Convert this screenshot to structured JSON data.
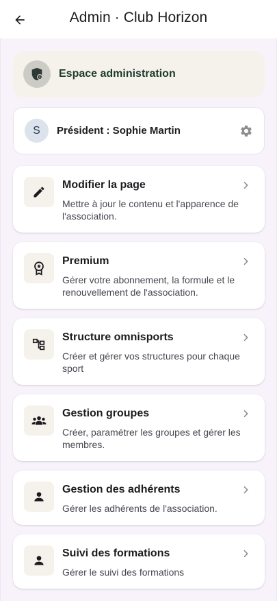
{
  "appbar": {
    "title": "Admin · Club Horizon",
    "back_icon": "arrow-left-icon"
  },
  "banner": {
    "label": "Espace administration",
    "icon": "shield-admin-icon"
  },
  "president": {
    "initial": "S",
    "label": "Président : Sophie Martin",
    "settings_icon": "gear-icon"
  },
  "menu": [
    {
      "title": "Modifier la page",
      "description": "Mettre à jour le contenu et l'apparence de l'association.",
      "icon": "pencil-icon"
    },
    {
      "title": "Premium",
      "description": "Gérer votre abonnement, la formule et le renouvellement de l'association.",
      "icon": "award-icon"
    },
    {
      "title": "Structure omnisports",
      "description": "Créer et gérer vos structures pour chaque sport",
      "icon": "hierarchy-icon"
    },
    {
      "title": "Gestion groupes",
      "description": "Créer, paramétrer les groupes et gérer les membres.",
      "icon": "group-icon"
    },
    {
      "title": "Gestion des adhérents",
      "description": "Gérer les adhérents de l'association.",
      "icon": "person-icon"
    },
    {
      "title": "Suivi des formations",
      "description": "Gérer le suivi des formations",
      "icon": "person-icon"
    }
  ],
  "colors": {
    "page_background": "#f8f3fb",
    "banner_background": "#f5f2ec",
    "banner_text": "#1f3a2e",
    "card_background": "#ffffff"
  }
}
